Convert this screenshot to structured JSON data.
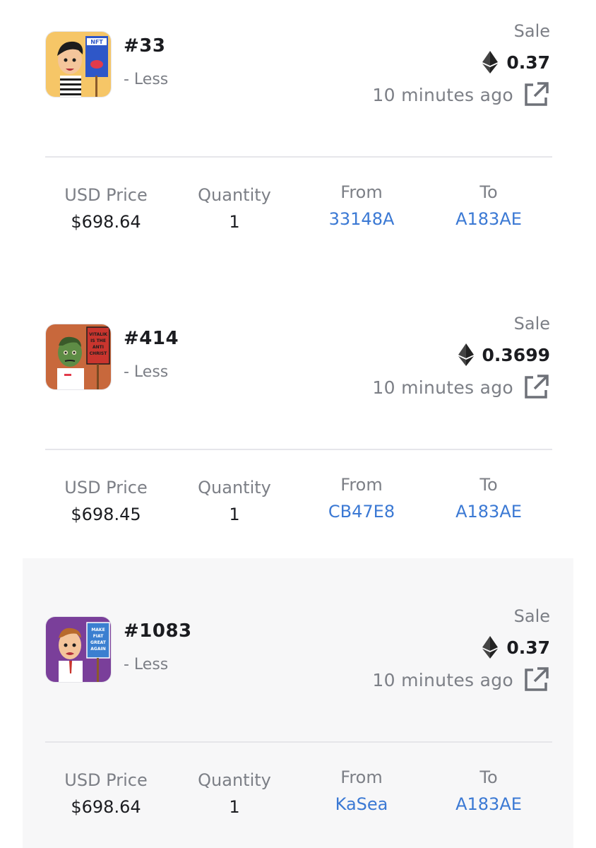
{
  "sales": [
    {
      "token_id": "#33",
      "less_label": "- Less",
      "sale_label": "Sale",
      "price_eth": "0.37",
      "time_ago": "10 minutes ago",
      "usd_price_label": "USD Price",
      "usd_price": "$698.64",
      "quantity_label": "Quantity",
      "quantity": "1",
      "from_label": "From",
      "from": "33148A",
      "to_label": "To",
      "to": "A183AE",
      "thumb_sign_text": "NFT"
    },
    {
      "token_id": "#414",
      "less_label": "- Less",
      "sale_label": "Sale",
      "price_eth": "0.3699",
      "time_ago": "10 minutes ago",
      "usd_price_label": "USD Price",
      "usd_price": "$698.45",
      "quantity_label": "Quantity",
      "quantity": "1",
      "from_label": "From",
      "from": "CB47E8",
      "to_label": "To",
      "to": "A183AE",
      "thumb_sign_text": "VITALIK IS THE ANTI CHRIST"
    },
    {
      "token_id": "#1083",
      "less_label": "- Less",
      "sale_label": "Sale",
      "price_eth": "0.37",
      "time_ago": "10 minutes ago",
      "usd_price_label": "USD Price",
      "usd_price": "$698.64",
      "quantity_label": "Quantity",
      "quantity": "1",
      "from_label": "From",
      "from": "KaSea",
      "to_label": "To",
      "to": "A183AE",
      "thumb_sign_text": "MAKE FIAT GREAT AGAIN"
    }
  ],
  "colors": {
    "link": "#3b79d4",
    "muted": "#7c7f86",
    "thumb_bg_1": "#f6c667",
    "thumb_bg_2": "#c8683c",
    "thumb_bg_3": "#7a3f9a"
  },
  "icons": {
    "currency": "ethereum-icon",
    "link": "external-link-icon"
  }
}
